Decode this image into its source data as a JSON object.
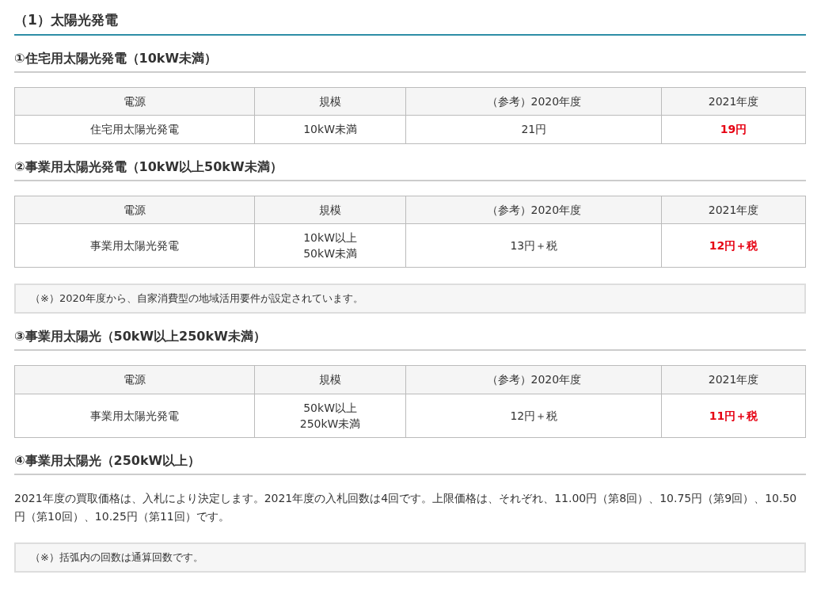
{
  "title": "（1）太陽光発電",
  "sections": [
    {
      "kind": "heading",
      "text": "①住宅用太陽光発電（10kW未満）"
    },
    {
      "kind": "table",
      "columns": [
        "電源",
        "規模",
        "（参考）2020年度",
        "2021年度"
      ],
      "rows": [
        [
          {
            "lines": [
              "住宅用太陽光発電"
            ],
            "highlight": false
          },
          {
            "lines": [
              "10kW未満"
            ],
            "highlight": false
          },
          {
            "lines": [
              "21円"
            ],
            "highlight": false
          },
          {
            "lines": [
              "19円"
            ],
            "highlight": true
          }
        ]
      ]
    },
    {
      "kind": "heading",
      "text": "②事業用太陽光発電（10kW以上50kW未満）"
    },
    {
      "kind": "table",
      "columns": [
        "電源",
        "規模",
        "（参考）2020年度",
        "2021年度"
      ],
      "rows": [
        [
          {
            "lines": [
              "事業用太陽光発電"
            ],
            "highlight": false
          },
          {
            "lines": [
              "10kW以上",
              "50kW未満"
            ],
            "highlight": false
          },
          {
            "lines": [
              "13円＋税"
            ],
            "highlight": false
          },
          {
            "lines": [
              "12円＋税"
            ],
            "highlight": true
          }
        ]
      ]
    },
    {
      "kind": "note",
      "text": "（※）2020年度から、自家消費型の地域活用要件が設定されています。"
    },
    {
      "kind": "heading",
      "text": "③事業用太陽光（50kW以上250kW未満）"
    },
    {
      "kind": "table",
      "columns": [
        "電源",
        "規模",
        "（参考）2020年度",
        "2021年度"
      ],
      "rows": [
        [
          {
            "lines": [
              "事業用太陽光発電"
            ],
            "highlight": false
          },
          {
            "lines": [
              "50kW以上",
              "250kW未満"
            ],
            "highlight": false
          },
          {
            "lines": [
              "12円＋税"
            ],
            "highlight": false
          },
          {
            "lines": [
              "11円＋税"
            ],
            "highlight": true
          }
        ]
      ]
    },
    {
      "kind": "heading",
      "text": "④事業用太陽光（250kW以上）"
    },
    {
      "kind": "paragraph",
      "text": "2021年度の買取価格は、入札により決定します。2021年度の入札回数は4回です。上限価格は、それぞれ、11.00円（第8回）、10.75円（第9回）、10.50円（第10回）、10.25円（第11回）です。"
    },
    {
      "kind": "note",
      "text": "（※）括弧内の回数は通算回数です。"
    }
  ]
}
